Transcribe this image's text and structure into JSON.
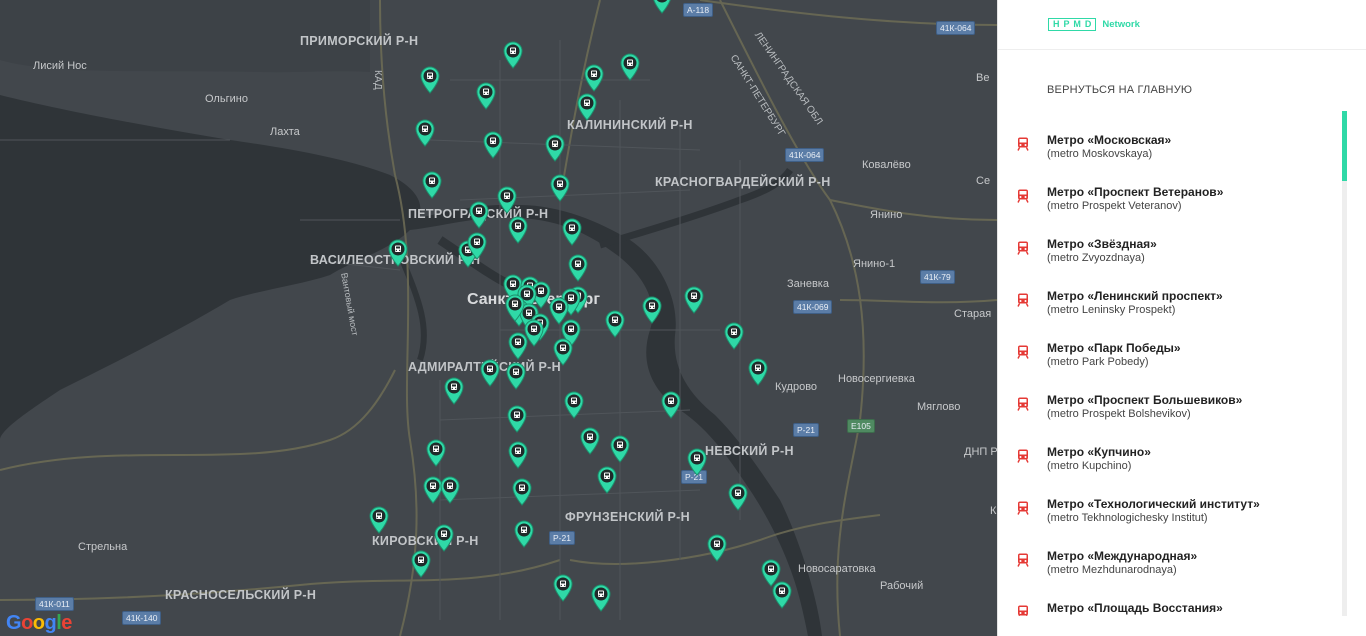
{
  "map": {
    "districts": [
      "ПРИМОРСКИЙ Р-Н",
      "КАЛИНИНСКИЙ Р-Н",
      "КРАСНОГВАРДЕЙСКИЙ Р-Н",
      "ПЕТРОГРАДСКИЙ Р-Н",
      "ВАСИЛЕОСТРОВСКИЙ Р-Н",
      "АДМИРАЛТЕЙСКИЙ Р-Н",
      "НЕВСКИЙ Р-Н",
      "ФРУНЗЕНСКИЙ Р-Н",
      "КИРОВСКИЙ Р-Н",
      "КРАСНОСЕЛЬСКИЙ Р-Н"
    ],
    "city": "Санкт-Петербург",
    "villages": [
      "Лисий Нос",
      "Ольгино",
      "Лахта",
      "Ковалёво",
      "Янино",
      "Янино-1",
      "Заневка",
      "Старая",
      "Кудрово",
      "Новосергиевка",
      "Мяглово",
      "Стрельна",
      "Новосаратовка",
      "Рабочий",
      "ДНП Р",
      "Ве",
      "Се",
      "К"
    ],
    "road_badges": [
      "А-118",
      "41К-064",
      "41К-064",
      "41К-79",
      "41К-069",
      "Р-21",
      "Е105",
      "Р-21",
      "Р-21",
      "41К-011",
      "41К-140"
    ],
    "road_names": [
      "САНКТ-ПЕТЕРБУРГ",
      "ЛЕНИНГРАДСКАЯ ОБЛ",
      "Вантовый мост",
      "КАД"
    ],
    "marker_icon": "metro-marker-icon",
    "marker_color": "#2fd9a7",
    "marker_count": 70,
    "attribution": "Google"
  },
  "sidebar": {
    "logo_mark": "НРМD",
    "logo_word": "Network",
    "back_link": "ВЕРНУТЬСЯ НА ГЛАВНУЮ",
    "item_icon": "train-icon",
    "item_icon_color": "#e53935",
    "accent_color": "#2fd9a7",
    "items": [
      {
        "ru": "Метро «Московская»",
        "en": "(metro Moskovskaya)"
      },
      {
        "ru": "Метро «Проспект Ветеранов»",
        "en": "(metro Prospekt Veteranov)"
      },
      {
        "ru": "Метро «Звёздная»",
        "en": "(metro Zvyozdnaya)"
      },
      {
        "ru": "Метро «Ленинский проспект»",
        "en": "(metro Leninsky Prospekt)"
      },
      {
        "ru": "Метро «Парк Победы»",
        "en": "(metro Park Pobedy)"
      },
      {
        "ru": "Метро «Проспект Большевиков»",
        "en": "(metro Prospekt Bolshevikov)"
      },
      {
        "ru": "Метро «Купчино»",
        "en": "(metro Kupchino)"
      },
      {
        "ru": "Метро «Технологический институт»",
        "en": "(metro Tekhnologichesky Institut)"
      },
      {
        "ru": "Метро «Международная»",
        "en": "(metro Mezhdunarodnaya)"
      },
      {
        "ru": "Метро «Площадь Восстания»",
        "en": ""
      }
    ]
  }
}
